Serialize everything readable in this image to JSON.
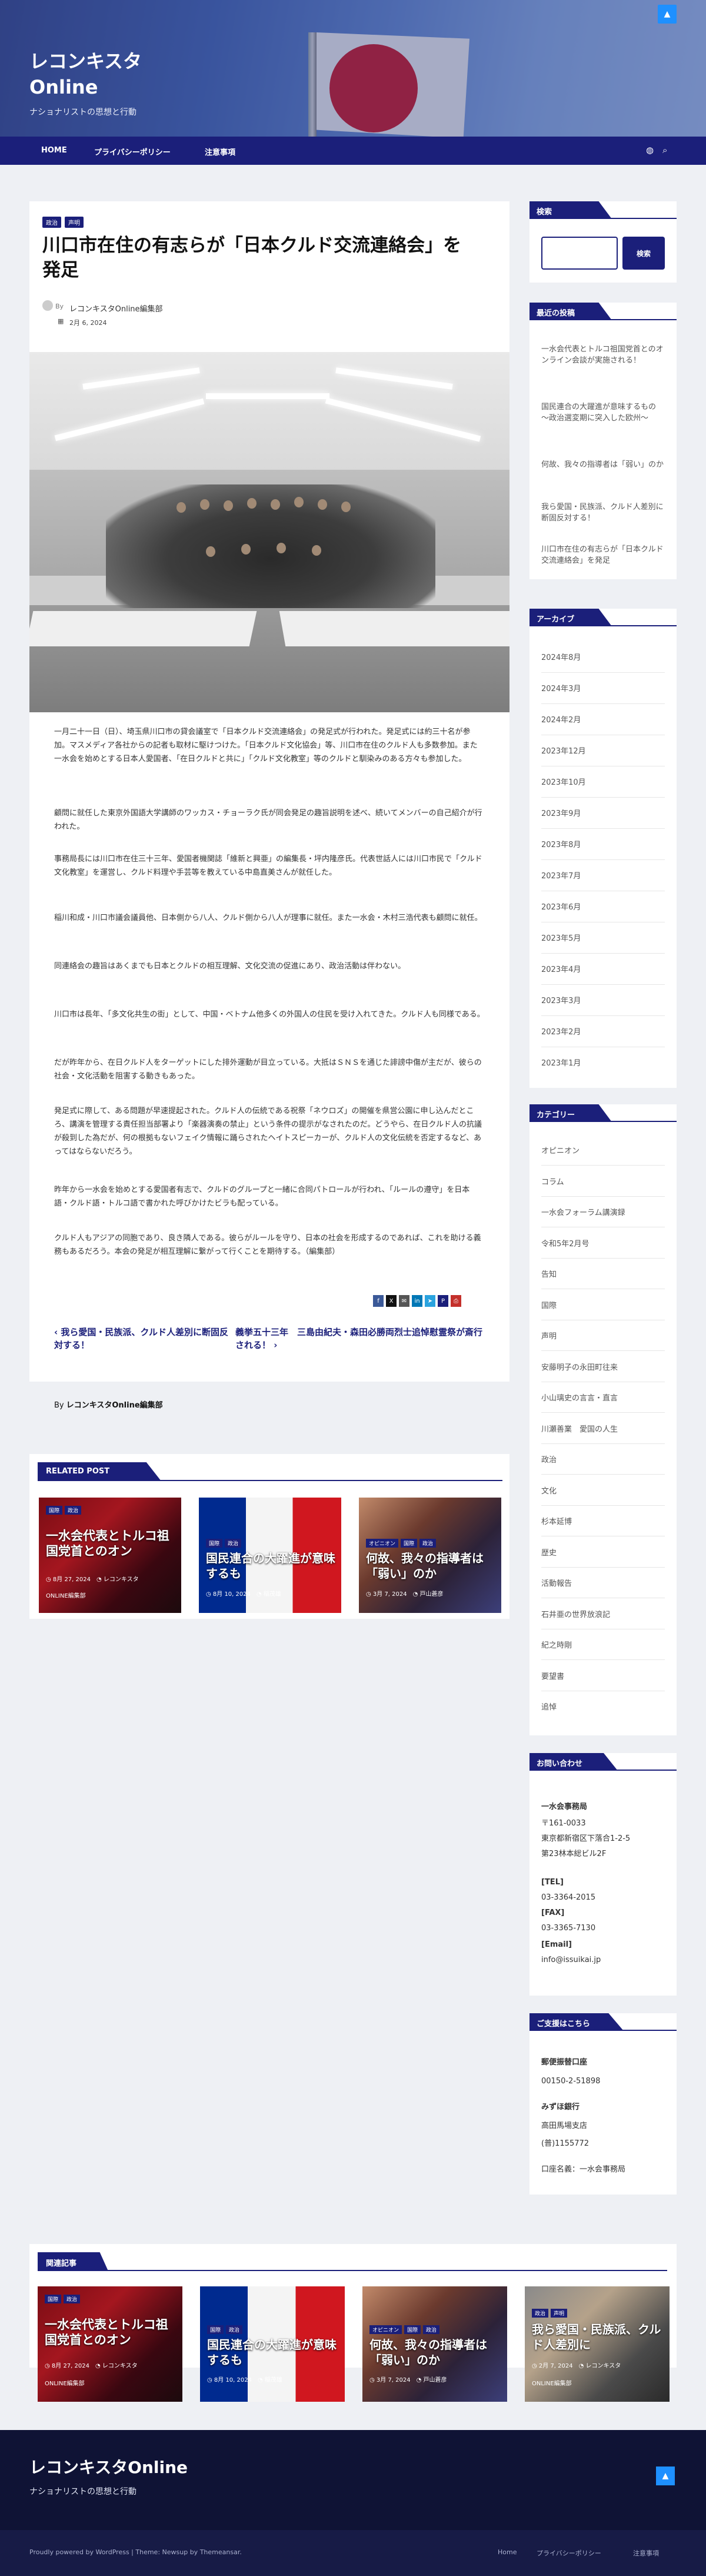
{
  "header": {
    "site_title": "レコンキスタOnline",
    "tagline": "ナショナリストの思想と行動"
  },
  "nav": {
    "items": [
      "HOME",
      "プライバシーポリシー",
      "注意事項"
    ]
  },
  "article": {
    "categories": [
      "政治",
      "声明"
    ],
    "title": "川口市在住の有志らが「日本クルド交流連絡会」を発足",
    "by_label": "By",
    "author": "レコンキスタOnline編集部",
    "date": "2月 6, 2024",
    "paragraphs": [
      "一月二十一日（日）、埼玉県川口市の貸会議室で「日本クルド交流連絡会」の発足式が行われた。発足式には約三十名が参加。マスメディア各社からの記者も取材に駆けつけた。「日本クルド文化協会」等、川口市在住のクルド人も多数参加。また一水会を始めとする日本人愛国者、「在日クルドと共に」「クルド文化教室」等のクルドと馴染みのある方々も参加した。",
      "顧問に就任した東京外国語大学講師のワッカス・チョーラク氏が同会発足の趣旨説明を述べ、続いてメンバーの自己紹介が行われた。",
      "事務局長には川口市在住三十三年、愛国者機関誌「維新と興亜」の編集長・坪内隆彦氏。代表世話人には川口市民で「クルド文化教室」を運営し、クルド料理や手芸等を教えている中島直美さんが就任した。",
      "稲川和成・川口市議会議員他、日本側から八人、クルド側から八人が理事に就任。また一水会・木村三浩代表も顧問に就任。",
      "同連絡会の趣旨はあくまでも日本とクルドの相互理解、文化交流の促進にあり、政治活動は伴わない。",
      "川口市は長年、「多文化共生の街」として、中国・ベトナム他多くの外国人の住民を受け入れてきた。クルド人も同様である。",
      "だが昨年から、在日クルド人をターゲットにした排外運動が目立っている。大抵はＳＮＳを通じた誹謗中傷が主だが、彼らの社会・文化活動を阻害する動きもあった。",
      "発足式に際して、ある問題が早速提起された。クルド人の伝統である祝祭「ネウロズ」の開催を県営公園に申し込んだところ、講演を管理する責任担当部署より「楽器演奏の禁止」という条件の提示がなされたのだ。どうやら、在日クルド人の抗議が殺到した為だが、何の根拠もないフェイク情報に踊らされたヘイトスピーカーが、クルド人の文化伝統を否定するなど、あってはならないだろう。",
      "昨年から一水会を始めとする愛国者有志で、クルドのグループと一緒に合同パトロールが行われ、「ルールの遵守」を日本語・クルド語・トルコ語で書かれた呼びかけたビラも配っている。",
      "クルド人もアジアの同胞であり、良き隣人である。彼らがルールを守り、日本の社会を形成するのであれば、これを助ける義務もあるだろう。本会の発足が相互理解に繋がって行くことを期待する。（編集部）"
    ],
    "prev_post": "我ら愛国・民族派、クルド人差別に断固反対する！",
    "next_post": "義挙五十三年　三島由紀夫・森田必勝両烈士追悼慰霊祭が斎行される！",
    "author_line_by": "By",
    "author_line_name": "レコンキスタOnline編集部"
  },
  "related_post": {
    "heading": "RELATED POST",
    "items": [
      {
        "cats": [
          "国際",
          "政治"
        ],
        "title": "一水会代表とトルコ祖国党首とのオン",
        "date": "8月 27, 2024",
        "author": "レコンキスタ",
        "extra": "ONLINE編集部"
      },
      {
        "cats": [
          "国際",
          "政治"
        ],
        "title": "国民連合の大躍進が意味するも",
        "date": "8月 10, 2024",
        "author": "稲茂雄",
        "extra": ""
      },
      {
        "cats": [
          "オピニオン",
          "国際",
          "政治"
        ],
        "title": "何故、我々の指導者は「弱い」のか",
        "date": "3月 7, 2024",
        "author": "戸山蒼彦",
        "extra": ""
      }
    ]
  },
  "sidebar": {
    "search": {
      "heading": "検索",
      "button": "検索",
      "placeholder": ""
    },
    "recent": {
      "heading": "最近の投稿",
      "items": [
        "一水会代表とトルコ祖国党首とのオンライン会談が実施される！",
        "国民連合の大躍進が意味するもの　～政治選変期に突入した欧州～",
        "何故、我々の指導者は「弱い」のか",
        "我ら愛国・民族派、クルド人差別に断固反対する！",
        "川口市在住の有志らが「日本クルド交流連絡会」を発足"
      ]
    },
    "archive": {
      "heading": "アーカイブ",
      "items": [
        "2024年8月",
        "2024年3月",
        "2024年2月",
        "2023年12月",
        "2023年10月",
        "2023年9月",
        "2023年8月",
        "2023年7月",
        "2023年6月",
        "2023年5月",
        "2023年4月",
        "2023年3月",
        "2023年2月",
        "2023年1月"
      ]
    },
    "categories": {
      "heading": "カテゴリー",
      "items": [
        "オピニオン",
        "コラム",
        "一水会フォーラム講演録",
        "令和5年2月号",
        "告知",
        "国際",
        "声明",
        "安藤明子の永田町往来",
        "小山璃史の言言・直言",
        "川瀬善業　愛国の人生",
        "政治",
        "文化",
        "杉本延博",
        "歴史",
        "活動報告",
        "石井亜の世界放浪記",
        "紀之時剛",
        "要望書",
        "追悼"
      ]
    },
    "contact": {
      "heading": "お問い合わせ",
      "org": "一水会事務局",
      "address": [
        "〒161-0033",
        "東京都新宿区下落合1-2-5",
        "第23林本総ビル2F"
      ],
      "tel_label": "[TEL]",
      "tel": "03-3364-2015",
      "fax_label": "[FAX]",
      "fax": "03-3365-7130",
      "email_label": "[Email]",
      "email": "info@issuikai.jp"
    },
    "support": {
      "heading": "ご支援はこちら",
      "postal_label": "郵便振替口座",
      "postal": "00150-2-51898",
      "bank": "みずほ銀行",
      "branch": "高田馬場支店",
      "account": "(普)1155772",
      "name": "口座名義：一水会事務局"
    }
  },
  "related_bottom": {
    "heading": "関連記事",
    "items": [
      {
        "cats": [
          "国際",
          "政治"
        ],
        "title": "一水会代表とトルコ祖国党首とのオン",
        "date": "8月 27, 2024",
        "author": "レコンキスタ",
        "extra": "ONLINE編集部"
      },
      {
        "cats": [
          "国際",
          "政治"
        ],
        "title": "国民連合の大躍進が意味するも",
        "date": "8月 10, 2024",
        "author": "稲茂雄",
        "extra": ""
      },
      {
        "cats": [
          "オピニオン",
          "国際",
          "政治"
        ],
        "title": "何故、我々の指導者は「弱い」のか",
        "date": "3月 7, 2024",
        "author": "戸山蒼彦",
        "extra": ""
      },
      {
        "cats": [
          "政治",
          "声明"
        ],
        "title": "我ら愛国・民族派、クルド人差別に",
        "date": "2月 7, 2024",
        "author": "レコンキスタ",
        "extra": "ONLINE編集部"
      }
    ]
  },
  "footer": {
    "title": "レコンキスタOnline",
    "tagline": "ナショナリストの思想と行動",
    "copyright": "Proudly powered by WordPress | Theme: Newsup by Themeansar.",
    "links": [
      "Home",
      "プライバシーポリシー",
      "注意事項"
    ]
  },
  "colors": {
    "primary": "#1b1f7a",
    "accent": "#1e90ff",
    "footer": "#0f1335"
  },
  "icons": [
    "chevron-up-icon",
    "globe-icon",
    "search-icon",
    "calendar-icon",
    "clock-icon",
    "user-icon",
    "facebook-icon",
    "twitter-icon",
    "email-icon",
    "linkedin-icon",
    "telegram-icon",
    "pinterest-icon",
    "print-icon"
  ]
}
